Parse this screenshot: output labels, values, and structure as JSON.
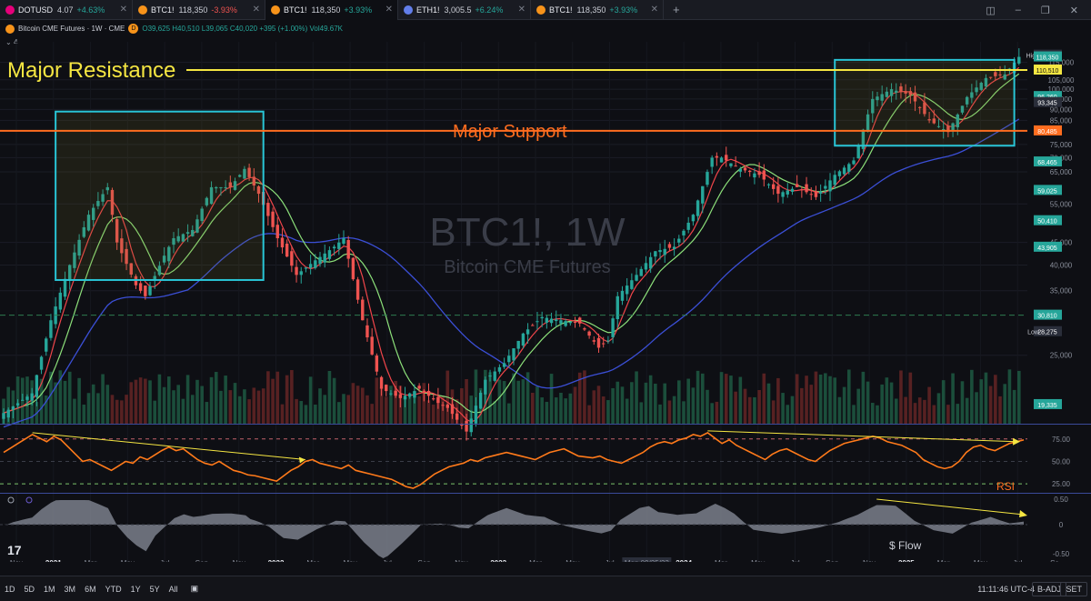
{
  "tabs": [
    {
      "symbol": "DOTUSD",
      "price": "4.07",
      "change": "+4.63%",
      "dir": "up",
      "coin_color": "#e6007a"
    },
    {
      "symbol": "BTC1!",
      "price": "118,350",
      "change": "-3.93%",
      "dir": "dn",
      "coin_color": "#f7931a"
    },
    {
      "symbol": "BTC1!",
      "price": "118,350",
      "change": "+3.93%",
      "dir": "up",
      "coin_color": "#f7931a",
      "active": true
    },
    {
      "symbol": "ETH1!",
      "price": "3,005.5",
      "change": "+6.24%",
      "dir": "up",
      "coin_color": "#627eea"
    },
    {
      "symbol": "BTC1!",
      "price": "118,350",
      "change": "+3.93%",
      "dir": "up",
      "coin_color": "#f7931a"
    }
  ],
  "new_tab_label": "+",
  "window_controls": [
    "layout-icon",
    "minimize-icon",
    "maximize-icon",
    "close-icon"
  ],
  "legend": {
    "title": "Bitcoin CME Futures · 1W · CME",
    "badge": "D",
    "ohlc": "O39,625  H40,510  L39,065  C40,020  +395 (+1.00%)  Vol49.67K",
    "indicator_count": "4"
  },
  "watermark": {
    "symbol": "BTC1!, 1W",
    "name": "Bitcoin CME Futures"
  },
  "annotations": {
    "resistance": "Major Resistance",
    "support": "Major Support",
    "rsi": "RSI",
    "flow": "$ Flow"
  },
  "colors": {
    "up": "#26a69a",
    "down": "#ef5350",
    "resistance": "#f5e642",
    "support": "#ff6d1f",
    "box": "#29c5d6",
    "ma_fast": "#f0454a",
    "ma_mid": "#8ce07a",
    "ma_slow": "#3b4fd6",
    "rsi": "#ff7a1a",
    "flow": "#9aa0ab"
  },
  "chart_data": {
    "type": "candlestick",
    "title": "Bitcoin CME Futures · 1W · CME",
    "y_scale": "log",
    "ylim": [
      17500,
      128000
    ],
    "y_ticks": [
      25000,
      35000,
      40000,
      45000,
      55000,
      65000,
      70000,
      75000,
      85000,
      90000,
      95000,
      100000,
      105000,
      115000
    ],
    "price_labels": [
      {
        "label": "High",
        "value": "119,450",
        "color": "#2a2e3a"
      },
      {
        "label": "",
        "value": "118,350",
        "color": "#26a69a"
      },
      {
        "label": "",
        "value": "110,510",
        "color": "#f5e642"
      },
      {
        "label": "",
        "value": "96,260",
        "color": "#26a69a"
      },
      {
        "label": "",
        "value": "93,345",
        "color": "#2a2e3a"
      },
      {
        "label": "",
        "value": "80,485",
        "color": "#ff6d1f"
      },
      {
        "label": "",
        "value": "68,465",
        "color": "#26a69a"
      },
      {
        "label": "",
        "value": "59,025",
        "color": "#26a69a"
      },
      {
        "label": "",
        "value": "50,410",
        "color": "#26a69a"
      },
      {
        "label": "",
        "value": "43,905",
        "color": "#26a69a"
      },
      {
        "label": "",
        "value": "30,810",
        "color": "#26a69a"
      },
      {
        "label": "Low",
        "value": "28,275",
        "color": "#2a2e3a"
      },
      {
        "label": "",
        "value": "19,335",
        "color": "#26a69a"
      }
    ],
    "levels": {
      "resistance": 110510,
      "support": 80485
    },
    "x_labels": [
      "Nov",
      "2021",
      "Mar",
      "May",
      "Jul",
      "Sep",
      "Nov",
      "2022",
      "Mar",
      "May",
      "Jul",
      "Sep",
      "Nov",
      "2023",
      "Mar",
      "May",
      "Jul",
      "Mon 09/25/23",
      "2024",
      "Mar",
      "May",
      "Jul",
      "Sep",
      "Nov",
      "2025",
      "Mar",
      "May",
      "Jul",
      "Se"
    ],
    "close_path": [
      [
        0,
        18500
      ],
      [
        6,
        20500
      ],
      [
        10,
        30000
      ],
      [
        14,
        40000
      ],
      [
        18,
        52000
      ],
      [
        22,
        60000
      ],
      [
        24,
        45000
      ],
      [
        28,
        36000
      ],
      [
        30,
        34000
      ],
      [
        34,
        42000
      ],
      [
        36,
        46000
      ],
      [
        40,
        48000
      ],
      [
        44,
        60000
      ],
      [
        48,
        60000
      ],
      [
        51,
        66000
      ],
      [
        54,
        58000
      ],
      [
        58,
        46000
      ],
      [
        62,
        38000
      ],
      [
        66,
        41000
      ],
      [
        70,
        44000
      ],
      [
        72,
        46000
      ],
      [
        76,
        30000
      ],
      [
        80,
        21000
      ],
      [
        84,
        20000
      ],
      [
        88,
        21000
      ],
      [
        92,
        19500
      ],
      [
        94,
        19000
      ],
      [
        98,
        16800
      ],
      [
        102,
        22000
      ],
      [
        106,
        24000
      ],
      [
        110,
        28000
      ],
      [
        114,
        30500
      ],
      [
        118,
        30000
      ],
      [
        122,
        29500
      ],
      [
        126,
        26000
      ],
      [
        128,
        27000
      ],
      [
        130,
        34000
      ],
      [
        134,
        38000
      ],
      [
        138,
        43000
      ],
      [
        142,
        44000
      ],
      [
        146,
        52000
      ],
      [
        150,
        70000
      ],
      [
        152,
        70000
      ],
      [
        156,
        66000
      ],
      [
        160,
        64000
      ],
      [
        164,
        58000
      ],
      [
        168,
        60000
      ],
      [
        172,
        57000
      ],
      [
        176,
        64000
      ],
      [
        180,
        69000
      ],
      [
        184,
        95000
      ],
      [
        188,
        100000
      ],
      [
        192,
        97000
      ],
      [
        196,
        85000
      ],
      [
        200,
        80000
      ],
      [
        204,
        96000
      ],
      [
        208,
        106000
      ],
      [
        212,
        108000
      ],
      [
        215,
        118350
      ]
    ],
    "rsi": {
      "ylim": [
        15,
        90
      ],
      "levels": [
        25,
        50,
        75
      ],
      "values": [
        60,
        65,
        70,
        75,
        80,
        76,
        72,
        78,
        74,
        66,
        58,
        50,
        52,
        48,
        44,
        40,
        45,
        50,
        48,
        55,
        52,
        57,
        62,
        66,
        62,
        64,
        58,
        52,
        48,
        46,
        50,
        45,
        40,
        38,
        35,
        34,
        32,
        30,
        28,
        34,
        40,
        44,
        50,
        52,
        48,
        46,
        44,
        42,
        46,
        40,
        38,
        36,
        34,
        32,
        30,
        26,
        22,
        20,
        24,
        30,
        36,
        40,
        44,
        46,
        48,
        52,
        50,
        54,
        56,
        58,
        60,
        58,
        56,
        54,
        52,
        56,
        60,
        62,
        64,
        60,
        56,
        55,
        54,
        56,
        52,
        50,
        48,
        52,
        56,
        60,
        66,
        70,
        72,
        70,
        74,
        76,
        80,
        78,
        82,
        76,
        70,
        74,
        68,
        64,
        60,
        56,
        52,
        58,
        62,
        64,
        60,
        56,
        52,
        50,
        56,
        62,
        66,
        70,
        72,
        74,
        76,
        78,
        76,
        72,
        70,
        68,
        64,
        60,
        52,
        48,
        44,
        42,
        44,
        50,
        60,
        66,
        68,
        64,
        62,
        66,
        70,
        72,
        74
      ]
    }
  }
}
